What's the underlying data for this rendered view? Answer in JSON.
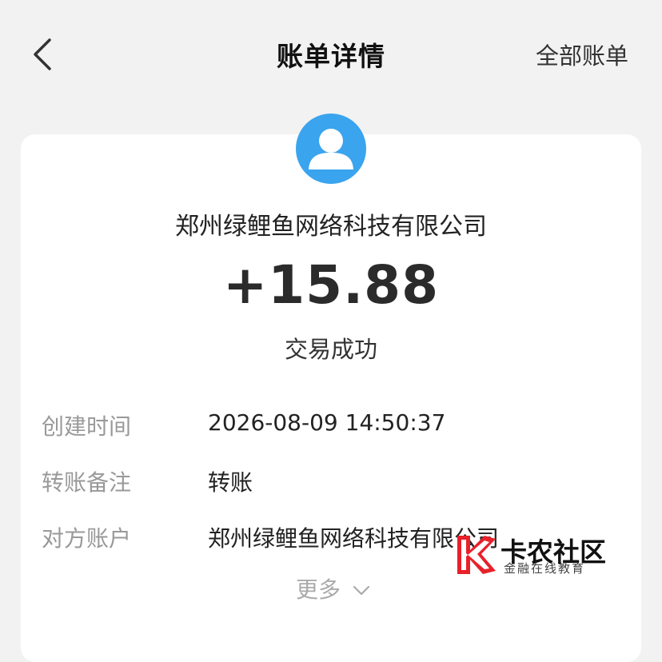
{
  "nav": {
    "title": "账单详情",
    "right_link": "全部账单"
  },
  "transaction": {
    "counterparty": "郑州绿鲤鱼网络科技有限公司",
    "amount": "+15.88",
    "status": "交易成功"
  },
  "details": [
    {
      "label": "创建时间",
      "value": "2026-08-09 14:50:37"
    },
    {
      "label": "转账备注",
      "value": "转账"
    },
    {
      "label": "对方账户",
      "value": "郑州绿鲤鱼网络科技有限公司"
    }
  ],
  "more_label": "更多",
  "watermark": {
    "title": "卡农社区",
    "subtitle": "金融在线教育"
  },
  "colors": {
    "avatar_bg": "#3aa4ee",
    "page_bg": "#f2f2f2",
    "watermark_red": "#e8202a"
  },
  "icons": [
    "back-arrow-icon",
    "user-avatar-icon",
    "chevron-down-icon",
    "kanong-logo-icon"
  ]
}
